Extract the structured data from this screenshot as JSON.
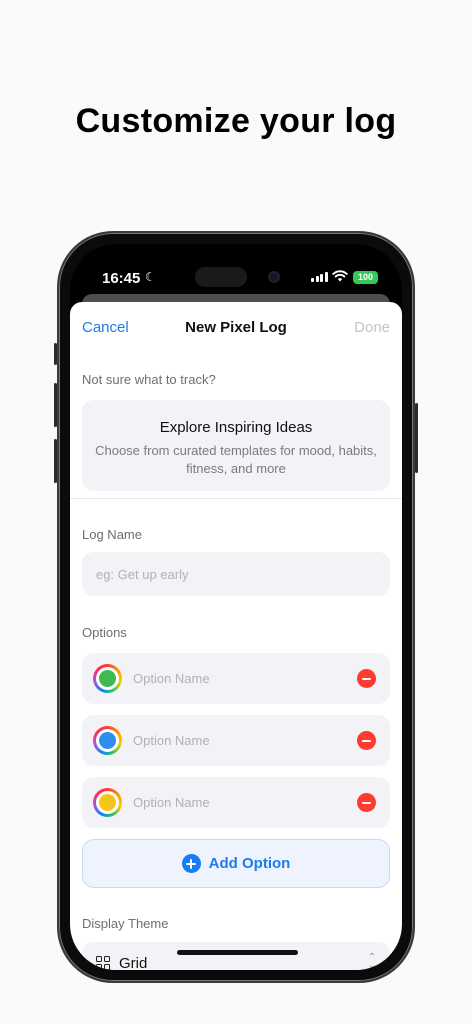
{
  "headline": "Customize your log",
  "status": {
    "time": "16:45",
    "battery": "100"
  },
  "nav": {
    "cancel": "Cancel",
    "title": "New Pixel Log",
    "done": "Done"
  },
  "ideas": {
    "prompt": "Not sure what to track?",
    "title": "Explore Inspiring Ideas",
    "subtitle": "Choose from curated templates for mood, habits, fitness, and more"
  },
  "log_name": {
    "label": "Log Name",
    "placeholder": "eg: Get up early"
  },
  "options": {
    "label": "Options",
    "items": [
      {
        "placeholder": "Option Name",
        "color": "#3fb950"
      },
      {
        "placeholder": "Option Name",
        "color": "#2f8cf0"
      },
      {
        "placeholder": "Option Name",
        "color": "#f5c518"
      }
    ],
    "add_label": "Add Option"
  },
  "theme": {
    "label": "Display Theme",
    "value": "Grid"
  },
  "colors": {
    "accent": "#1a7cf0",
    "destructive": "#ff3b30",
    "battery": "#34c759"
  }
}
